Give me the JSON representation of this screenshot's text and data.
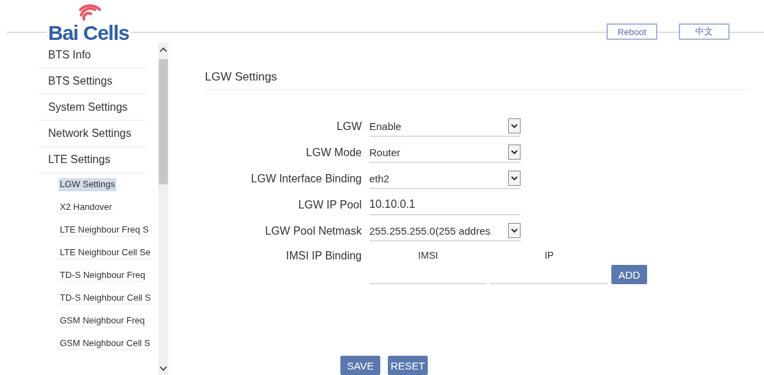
{
  "header": {
    "logo": "Bai Cells",
    "buttons": [
      {
        "label": "Reboot"
      },
      {
        "label": "中文"
      }
    ]
  },
  "sidebar": {
    "items": [
      {
        "label": "BTS Info",
        "selected": false
      },
      {
        "label": "BTS Settings",
        "selected": false
      },
      {
        "label": "System Settings",
        "selected": false
      },
      {
        "label": "Network Settings",
        "selected": false
      },
      {
        "label": "LTE Settings",
        "selected": false,
        "children": [
          {
            "label": "LGW Settings",
            "selected": true
          },
          {
            "label": "X2 Handover",
            "selected": false
          },
          {
            "label": "LTE Neighbour Freq S",
            "selected": false
          },
          {
            "label": "LTE Neighbour Cell Se",
            "selected": false
          },
          {
            "label": "TD-S Neighbour Freq",
            "selected": false
          },
          {
            "label": "TD-S Neighbour Cell S",
            "selected": false
          },
          {
            "label": "GSM Neighbour Freq",
            "selected": false
          },
          {
            "label": "GSM Neighbour Cell S",
            "selected": false
          }
        ]
      }
    ]
  },
  "main": {
    "title": "LGW Settings",
    "fields": [
      {
        "kind": "select",
        "label": "LGW",
        "value": "Enable"
      },
      {
        "kind": "select",
        "label": "LGW Mode",
        "value": "Router"
      },
      {
        "kind": "select",
        "label": "LGW Interface Binding",
        "value": "eth2"
      },
      {
        "kind": "text",
        "label": "LGW IP Pool",
        "value": "10.10.0.1"
      },
      {
        "kind": "select",
        "label": "LGW Pool Netmask",
        "value": "255.255.255.0(255 addres"
      }
    ],
    "binding": {
      "label": "IMSI IP Binding",
      "columns": [
        "IMSI",
        "IP"
      ],
      "add": "ADD"
    },
    "actions": [
      "SAVE",
      "RESET"
    ]
  }
}
